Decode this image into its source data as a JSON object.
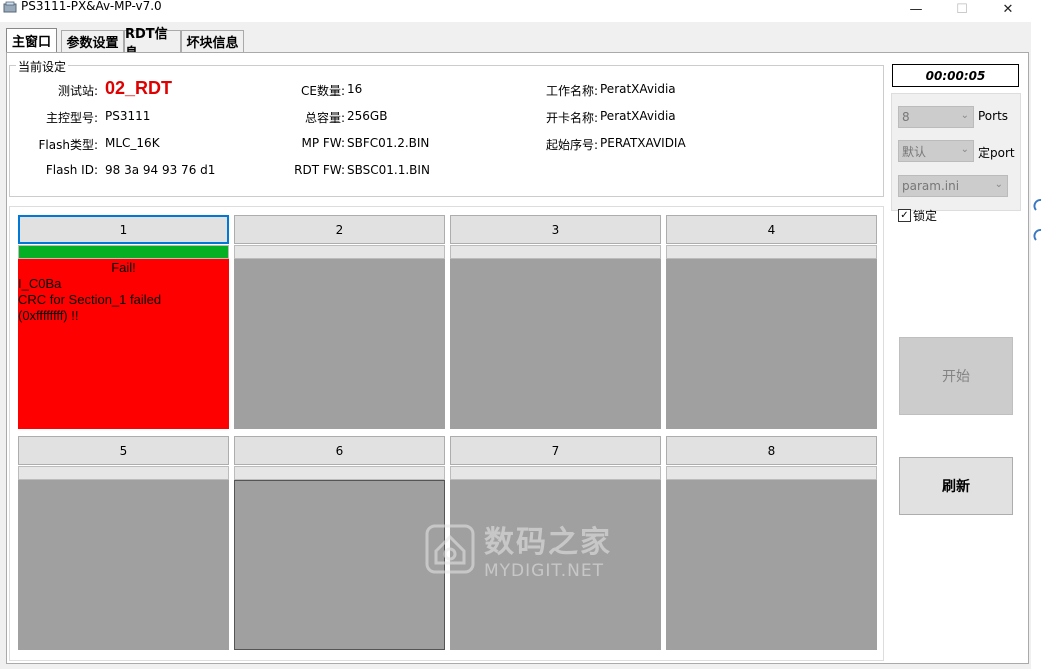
{
  "window": {
    "title": "PS3111-PX&Av-MP-v7.0",
    "minimize_glyph": "—",
    "maximize_glyph": "☐",
    "close_glyph": "✕"
  },
  "tabs": [
    "主窗口",
    "参数设置",
    "RDT信息",
    "坏块信息"
  ],
  "settings": {
    "group_title": "当前设定",
    "station_label": "测试站:",
    "station_value": "02_RDT",
    "controller_label": "主控型号:",
    "controller_value": "PS3111",
    "flash_type_label": "Flash类型:",
    "flash_type_value": "MLC_16K",
    "flash_id_label": "Flash ID:",
    "flash_id_value": "98 3a 94 93 76 d1",
    "ce_label": "CE数量:",
    "ce_value": "16",
    "capacity_label": "总容量:",
    "capacity_value": "256GB",
    "mpfw_label": "MP FW:",
    "mpfw_value": "SBFC01.2.BIN",
    "rdtfw_label": "RDT FW:",
    "rdtfw_value": "SBSC01.1.BIN",
    "work_name_label": "工作名称:",
    "work_name_value": "PeratXAvidia",
    "card_name_label": "开卡名称:",
    "card_name_value": "PeratXAvidia",
    "start_serial_label": "起始序号:",
    "start_serial_value": "PERATXAVIDIA"
  },
  "ports": [
    {
      "label": "1",
      "progress": 1.0,
      "status": "Fail!",
      "lines": [
        "I_C0Ba",
        "CRC for Section_1 failed",
        "(0xffffffff) !!"
      ]
    },
    {
      "label": "2",
      "progress": 0
    },
    {
      "label": "3",
      "progress": 0
    },
    {
      "label": "4",
      "progress": 0
    },
    {
      "label": "5",
      "progress": 0
    },
    {
      "label": "6",
      "progress": 0
    },
    {
      "label": "7",
      "progress": 0
    },
    {
      "label": "8",
      "progress": 0
    }
  ],
  "right_panel": {
    "timer": "00:00:05",
    "ports_count": "8",
    "ports_label": "Ports",
    "port_mode": "默认",
    "port_mode_label": "定port",
    "param_file": "param.ini",
    "lock_label": "锁定",
    "lock_checked": true,
    "start_button": "开始",
    "refresh_button": "刷新"
  },
  "watermark": {
    "cn": "数码之家",
    "en": "MYDIGIT.NET"
  },
  "colors": {
    "fail": "#ff0000",
    "progress_fill": "#06b025",
    "idle_panel": "#a0a0a0",
    "station_text": "#e00000"
  }
}
